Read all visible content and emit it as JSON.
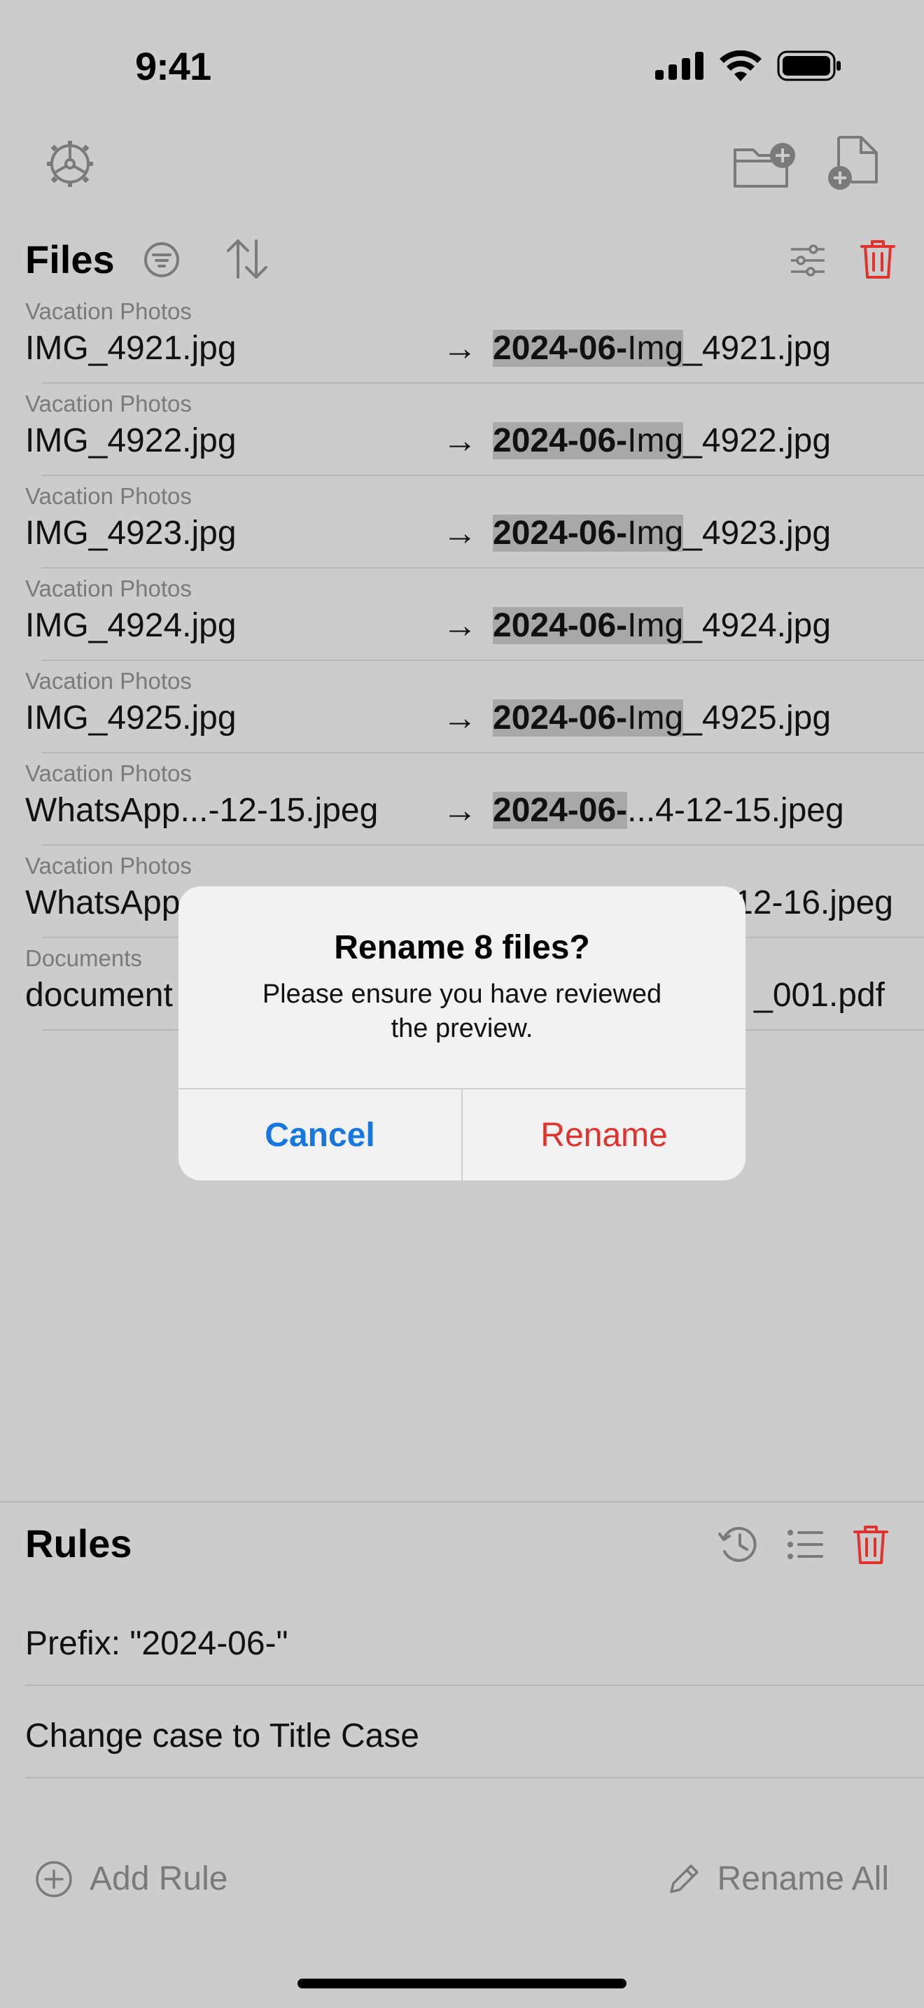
{
  "status": {
    "time": "9:41"
  },
  "files_section": {
    "title": "Files"
  },
  "files": [
    {
      "folder": "Vacation Photos",
      "original": "IMG_4921.jpg",
      "arrow": "→",
      "new_prefix": "2024-06-",
      "new_case": "Img",
      "new_rest": "_4921.jpg"
    },
    {
      "folder": "Vacation Photos",
      "original": "IMG_4922.jpg",
      "arrow": "→",
      "new_prefix": "2024-06-",
      "new_case": "Img",
      "new_rest": "_4922.jpg"
    },
    {
      "folder": "Vacation Photos",
      "original": "IMG_4923.jpg",
      "arrow": "→",
      "new_prefix": "2024-06-",
      "new_case": "Img",
      "new_rest": "_4923.jpg"
    },
    {
      "folder": "Vacation Photos",
      "original": "IMG_4924.jpg",
      "arrow": "→",
      "new_prefix": "2024-06-",
      "new_case": "Img",
      "new_rest": "_4924.jpg"
    },
    {
      "folder": "Vacation Photos",
      "original": "IMG_4925.jpg",
      "arrow": "→",
      "new_prefix": "2024-06-",
      "new_case": "Img",
      "new_rest": "_4925.jpg"
    },
    {
      "folder": "Vacation Photos",
      "original": "WhatsApp...-12-15.jpeg",
      "arrow": "→",
      "new_prefix": "2024-06-",
      "new_case": "",
      "new_rest": "...4-12-15.jpeg"
    },
    {
      "folder": "Vacation Photos",
      "original": "WhatsApp",
      "arrow": "",
      "new_prefix": "",
      "new_case": "",
      "new_rest": "12-16.jpeg"
    },
    {
      "folder": "Documents",
      "original": "document",
      "arrow": "",
      "new_prefix": "",
      "new_case": "",
      "new_rest": "_001.pdf"
    }
  ],
  "rules_section": {
    "title": "Rules"
  },
  "rules": [
    {
      "label": "Prefix: \"2024-06-\""
    },
    {
      "label": "Change case to Title Case"
    }
  ],
  "bottom": {
    "add_rule": "Add Rule",
    "rename_all": "Rename All"
  },
  "dialog": {
    "title": "Rename 8 files?",
    "message": "Please ensure you have reviewed the preview.",
    "cancel": "Cancel",
    "confirm": "Rename"
  },
  "colors": {
    "background": "#cccccc",
    "accent_blue": "#1677e0",
    "destructive_red": "#e0332e",
    "highlight": "#a8a8a8"
  }
}
